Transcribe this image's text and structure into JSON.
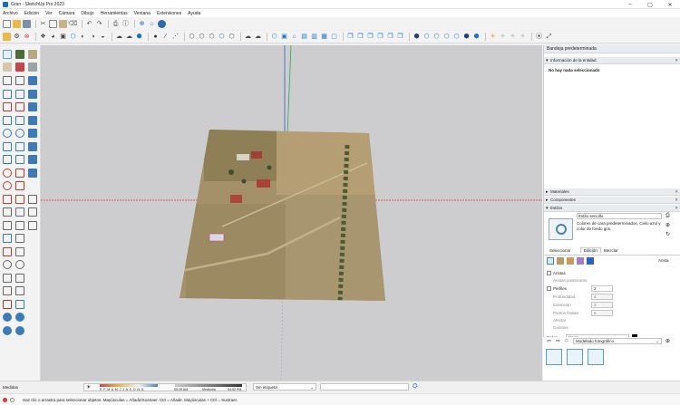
{
  "window": {
    "title": "Gran - SketchUp Pro 2023",
    "minimize": "–",
    "maximize": "▢",
    "close": "✕"
  },
  "menu": [
    "Archivo",
    "Edición",
    "Ver",
    "Cámara",
    "Dibujo",
    "Herramientas",
    "Ventana",
    "Extensiones",
    "Ayuda"
  ],
  "icons": {
    "toolbar_row1": [
      "new-file-icon",
      "open-icon",
      "save-icon",
      "cut-icon",
      "copy-icon",
      "paste-icon",
      "erase-icon",
      "undo-icon",
      "redo-icon",
      "print-icon",
      "model-info-icon",
      "zoom-extents-icon",
      "warehouse-icon",
      "extension-warehouse-icon"
    ],
    "toolbar_row2": [
      "open-folder-icon",
      "settings-gear-icon",
      "delete-icon",
      "components-icon",
      "materials-icon",
      "styles-icon",
      "iso-view-icon",
      "top-view-icon",
      "front-view-icon",
      "xray-icon",
      "hidden-line-icon",
      "shaded-icon",
      "textured-icon",
      "monochrome-icon",
      "cloud-upload-icon",
      "cloud-download-icon",
      "geo-location-icon",
      "add-location-icon",
      "sandbox-from-contours-icon",
      "sandbox-scratch-icon",
      "sandbox-smoove-icon",
      "sandbox-stamp-icon",
      "sandbox-drape-icon",
      "sandbox-add-detail-icon",
      "sandbox-flip-edge-icon",
      "section-plane-icon",
      "display-section-planes-icon",
      "display-section-cuts-icon",
      "iso-camera-icon",
      "top-camera-icon",
      "front-camera-icon",
      "right-camera-icon",
      "back-camera-icon",
      "left-camera-icon",
      "bottom-camera-icon",
      "solid-outer-shell-icon",
      "solid-intersect-icon",
      "solid-union-icon",
      "solid-subtract-icon",
      "solid-trim-icon",
      "solid-split-icon",
      "warehouse-share-icon",
      "layout-send-icon",
      "extension-manager-icon",
      "components-3d-icon",
      "layers-icon",
      "shadows-icon",
      "sun-icon",
      "fog-icon",
      "cast-shadows-icon",
      "receive-shadows-icon",
      "position-camera-icon",
      "walk-icon"
    ]
  },
  "tray": {
    "title": "Bandeja predeterminada",
    "entity_info": {
      "heading": "Información de la entidad",
      "message": "No hay nada seleccionado"
    },
    "materials": "Materiales",
    "components": "Componentes",
    "styles": {
      "heading": "Estilos",
      "style_name": "Estilo sencillo",
      "style_desc": "Colores de cara predeterminados. Cielo azul y color de fondo gris.",
      "tabs": [
        "Seleccionar",
        "Edición",
        "Mezclar"
      ],
      "section_label": "Arista",
      "options": [
        {
          "label": "Aristas",
          "value": "",
          "checked": true,
          "enabled": true
        },
        {
          "label": "Aristas posteriores",
          "value": "",
          "checked": false,
          "enabled": false
        },
        {
          "label": "Perfiles",
          "value": "2",
          "checked": true,
          "enabled": true
        },
        {
          "label": "Profundidad",
          "value": "4",
          "checked": false,
          "enabled": false
        },
        {
          "label": "Extensión",
          "value": "3",
          "checked": false,
          "enabled": false
        },
        {
          "label": "Puntos finales",
          "value": "6",
          "checked": false,
          "enabled": false
        },
        {
          "label": "Afectar",
          "value": "",
          "checked": false,
          "enabled": false
        },
        {
          "label": "Guiones",
          "value": "",
          "checked": false,
          "enabled": false
        }
      ],
      "color_label": "Color:",
      "color_value": "Único",
      "color_swatch": "#000000",
      "select_heading": "Seleccionar",
      "collection": "Modelado fotográfico"
    }
  },
  "statusbar": {
    "measures_label": "Medidas",
    "months": "E F M A M J J A S O N D",
    "time_start": "05:39 AM",
    "time_mid": "Mediodía",
    "time_end": "04:52 PM",
    "tag": "Sin etiqueta",
    "hint": "Haz clic o arrastra para seleccionar objetos. Mayúsculas = Añadir/Sustraer. Ctrl = Añadir. Mayúsculas + Ctrl = Sustraer."
  },
  "colors": {
    "viewport_bg": "#cdcdcf",
    "axis_red": "#d9343a",
    "axis_green": "#2fa84a",
    "axis_blue": "#3558d6"
  }
}
